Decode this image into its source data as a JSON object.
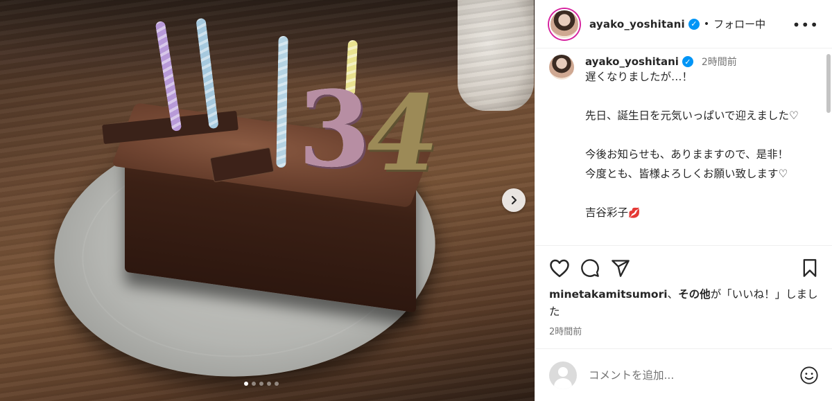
{
  "post": {
    "username": "ayako_yoshitani",
    "separator": "•",
    "follow_status": "フォロー中",
    "more_label": "•••",
    "verified_glyph": "✓"
  },
  "caption": {
    "username": "ayako_yoshitani",
    "time": "2時間前",
    "text": "遅くなりましたが…！\n\n先日、誕生日を元気いっぱいで迎えました♡\n\n今後お知らせも、ありまますので、是非！\n今度とも、皆様よろしくお願い致します♡\n\n吉谷彩子",
    "signature_emoji": "💋"
  },
  "media": {
    "alt": "34歳の誕生日ケーキ",
    "candle_digits": [
      "3",
      "4"
    ],
    "carousel": {
      "count": 5,
      "active_index": 0
    }
  },
  "actions": {
    "like_icon": "heart-icon",
    "comment_icon": "comment-icon",
    "share_icon": "share-icon",
    "save_icon": "bookmark-icon"
  },
  "likes": {
    "user": "minetakamitsumori",
    "middle": "、",
    "others": "その他",
    "suffix": "が「いいね！」しました"
  },
  "post_time": "2時間前",
  "comment_box": {
    "placeholder": "コメントを追加...",
    "emoji_icon": "smiley-icon"
  },
  "colors": {
    "verified": "#0095f6",
    "story_ring": "#d6249f",
    "muted_text": "#737373",
    "divider": "#efefef"
  }
}
